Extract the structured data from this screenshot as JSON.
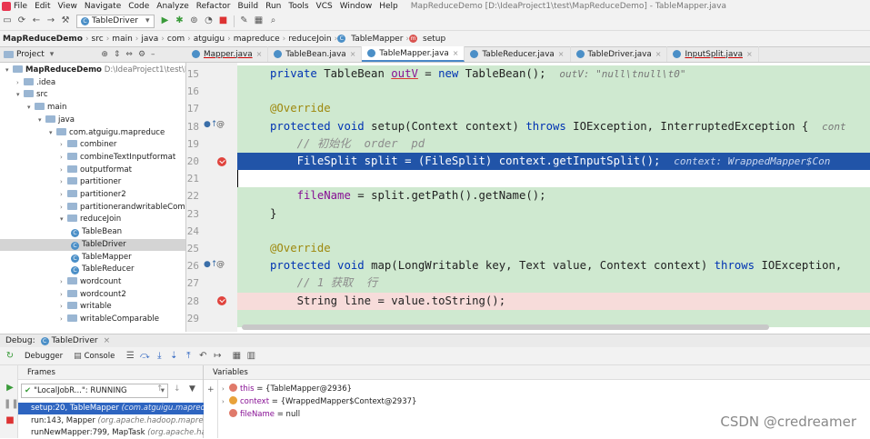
{
  "menu": {
    "items": [
      "File",
      "Edit",
      "View",
      "Navigate",
      "Code",
      "Analyze",
      "Refactor",
      "Build",
      "Run",
      "Tools",
      "VCS",
      "Window",
      "Help"
    ],
    "window_title": "MapReduceDemo [D:\\IdeaProject1\\test\\MapReduceDemo] - TableMapper.java"
  },
  "toolbar": {
    "run_config": "TableDriver"
  },
  "breadcrumb": [
    "MapReduceDemo",
    "src",
    "main",
    "java",
    "com",
    "atguigu",
    "mapreduce",
    "reduceJoin",
    "TableMapper",
    "setup"
  ],
  "project": {
    "title": "Project",
    "tree": [
      {
        "label": "MapReduceDemo",
        "path": "D:\\IdeaProject1\\test\\M",
        "depth": 0,
        "kind": "root",
        "arrow": "down"
      },
      {
        "label": ".idea",
        "depth": 1,
        "kind": "folder",
        "arrow": "right"
      },
      {
        "label": "src",
        "depth": 1,
        "kind": "folder",
        "arrow": "down"
      },
      {
        "label": "main",
        "depth": 2,
        "kind": "folder",
        "arrow": "down"
      },
      {
        "label": "java",
        "depth": 3,
        "kind": "folder",
        "arrow": "down"
      },
      {
        "label": "com.atguigu.mapreduce",
        "depth": 4,
        "kind": "folder",
        "arrow": "down"
      },
      {
        "label": "combiner",
        "depth": 5,
        "kind": "folder",
        "arrow": "right"
      },
      {
        "label": "combineTextInputformat",
        "depth": 5,
        "kind": "folder",
        "arrow": "right"
      },
      {
        "label": "outputformat",
        "depth": 5,
        "kind": "folder",
        "arrow": "right"
      },
      {
        "label": "partitioner",
        "depth": 5,
        "kind": "folder",
        "arrow": "right"
      },
      {
        "label": "partitioner2",
        "depth": 5,
        "kind": "folder",
        "arrow": "right"
      },
      {
        "label": "partitionerandwritableCom",
        "depth": 5,
        "kind": "folder",
        "arrow": "right"
      },
      {
        "label": "reduceJoin",
        "depth": 5,
        "kind": "folder",
        "arrow": "down"
      },
      {
        "label": "TableBean",
        "depth": 6,
        "kind": "class"
      },
      {
        "label": "TableDriver",
        "depth": 6,
        "kind": "class",
        "selected": true
      },
      {
        "label": "TableMapper",
        "depth": 6,
        "kind": "class"
      },
      {
        "label": "TableReducer",
        "depth": 6,
        "kind": "class"
      },
      {
        "label": "wordcount",
        "depth": 5,
        "kind": "folder",
        "arrow": "right"
      },
      {
        "label": "wordcount2",
        "depth": 5,
        "kind": "folder",
        "arrow": "right"
      },
      {
        "label": "writable",
        "depth": 5,
        "kind": "folder",
        "arrow": "right"
      },
      {
        "label": "writableComparable",
        "depth": 5,
        "kind": "folder",
        "arrow": "right"
      }
    ]
  },
  "tabs": [
    {
      "label": "Mapper.java",
      "underline": true
    },
    {
      "label": "TableBean.java"
    },
    {
      "label": "TableMapper.java",
      "active": true
    },
    {
      "label": "TableReducer.java"
    },
    {
      "label": "TableDriver.java"
    },
    {
      "label": "InputSplit.java",
      "underline": true
    }
  ],
  "code": {
    "line_numbers": [
      "15",
      "16",
      "17",
      "18",
      "19",
      "20",
      "21",
      "22",
      "23",
      "24",
      "25",
      "26",
      "27",
      "28",
      "29"
    ],
    "l15": {
      "kw1": "private",
      "t1": " TableBean ",
      "fld": "outV",
      "t2": " = ",
      "kw2": "new",
      "t3": " TableBean();  ",
      "hint": "outV: \"null\\tnull\\t0\""
    },
    "l17": {
      "ann": "@Override"
    },
    "l18": {
      "kw1": "protected",
      "sp1": " ",
      "kw2": "void",
      "t1": " setup(Context context) ",
      "kw3": "throws",
      "t2": " IOException, InterruptedException {  ",
      "hint": "cont"
    },
    "l19": {
      "cmt": "    // 初始化  order  pd"
    },
    "l20": {
      "t": "    FileSplit split = (FileSplit) context.getInputSplit();  ",
      "hint": "context: WrappedMapper$Con"
    },
    "l22": {
      "ind": "    ",
      "fld": "fileName",
      "t": " = split.getPath().getName();"
    },
    "l23": {
      "t": "}"
    },
    "l25": {
      "ann": "@Override"
    },
    "l26": {
      "kw1": "protected",
      "sp1": " ",
      "kw2": "void",
      "t1": " map(LongWritable key, Text value, Context context) ",
      "kw3": "throws",
      "t2": " IOException,"
    },
    "l27": {
      "cmt": "    // 1 获取  行"
    },
    "l28": {
      "t": "    String line = value.toString();"
    }
  },
  "debug": {
    "label": "Debug:",
    "config": "TableDriver",
    "tab_debugger": "Debugger",
    "tab_console": "Console",
    "frames_title": "Frames",
    "variables_title": "Variables",
    "thread": "\"LocalJobR...\": RUNNING",
    "frames": [
      {
        "method": "setup:20, TableMapper",
        "pkg": "(com.atguigu.mapreduce",
        "selected": true
      },
      {
        "method": "run:143, Mapper",
        "pkg": "(org.apache.hadoop.mapredu"
      },
      {
        "method": "runNewMapper:799, MapTask",
        "pkg": "(org.apache.hado"
      }
    ],
    "vars": [
      {
        "name": "this",
        "value": " = {TableMapper@2936}",
        "icon": "field"
      },
      {
        "name": "context",
        "value": " = {WrappedMapper$Context@2937}",
        "icon": "param"
      },
      {
        "name": "fileName",
        "value": " = null",
        "icon": "field"
      }
    ]
  },
  "watermark": "CSDN @credreamer",
  "colors": {
    "accent": "#2154a8",
    "breakpoint": "#e0443e",
    "green_bg": "#cfe9d0"
  }
}
